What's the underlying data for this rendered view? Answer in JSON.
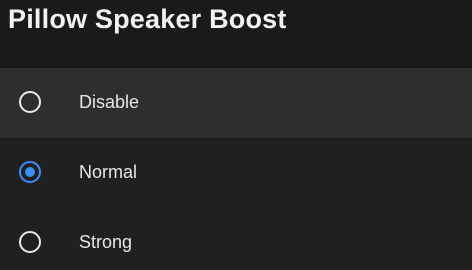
{
  "dialog": {
    "title": "Pillow Speaker Boost",
    "options": [
      {
        "label": "Disable",
        "selected": false
      },
      {
        "label": "Normal",
        "selected": true
      },
      {
        "label": "Strong",
        "selected": false
      }
    ]
  },
  "colors": {
    "accent": "#3d8df5",
    "background": "#202020",
    "focused_row": "#2e2e2e",
    "text": "#e6e6e6"
  }
}
